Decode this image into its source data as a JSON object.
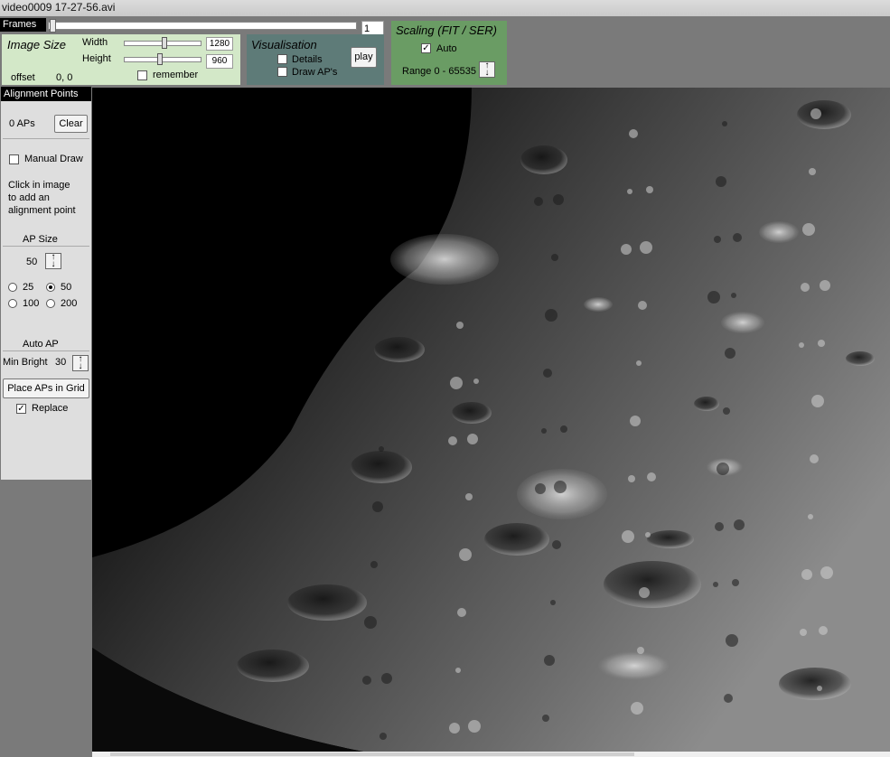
{
  "window": {
    "title": "video0009 17-27-56.avi"
  },
  "frames": {
    "label": "Frames",
    "current": "1",
    "position": 0.0
  },
  "image_size": {
    "title": "Image Size",
    "width_label": "Width",
    "width_value": "1280",
    "height_label": "Height",
    "height_value": "960",
    "remember_label": "remember",
    "offset_label": "offset",
    "offset_value": "0, 0"
  },
  "visualisation": {
    "title": "Visualisation",
    "details_label": "Details",
    "draw_aps_label": "Draw AP's",
    "play_label": "play"
  },
  "scaling": {
    "title": "Scaling (FIT / SER)",
    "auto_label": "Auto",
    "auto_checked": true,
    "range_label": "Range 0 - 65535"
  },
  "sidebar": {
    "header": "Alignment Points",
    "ap_count": "0 APs",
    "clear_label": "Clear",
    "manual_draw_label": "Manual Draw",
    "help_text": [
      "Click in image",
      "to add an",
      "alignment point"
    ],
    "ap_size_title": "AP Size",
    "ap_size_value": "50",
    "size_options": [
      "25",
      "50",
      "100",
      "200"
    ],
    "size_selected": "50",
    "auto_ap_title": "Auto AP",
    "min_bright_label": "Min Bright",
    "min_bright_value": "30",
    "place_grid_label": "Place APs in Grid",
    "replace_label": "Replace"
  },
  "colors": {
    "image_size_panel": "#d3e8c8",
    "visualisation_panel": "#5e7b78",
    "scaling_panel": "#6a9c64"
  },
  "icons": {
    "spinner": "up-down-arrows-icon",
    "check": "checkmark-icon"
  }
}
